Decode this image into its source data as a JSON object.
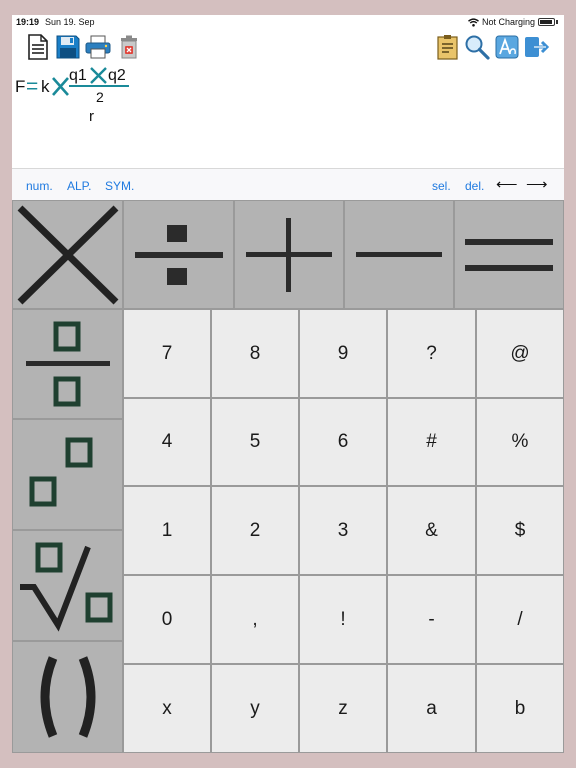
{
  "status_bar": {
    "time": "19:19",
    "date": "Sun 19. Sep",
    "network": "Not Charging"
  },
  "toolbar": {
    "left_icons": [
      "new-document-icon",
      "save-icon",
      "print-icon",
      "trash-icon"
    ],
    "right_icons": [
      "notes-icon",
      "search-icon",
      "font-icon",
      "export-icon"
    ]
  },
  "formula": {
    "f": "F",
    "eq": "=",
    "k": "k",
    "q1": "q1",
    "q2": "q2",
    "exp": "2",
    "r": "r"
  },
  "mode_bar": {
    "num": "num.",
    "alp": "ALP.",
    "sym": "SYM.",
    "sel": "sel.",
    "del": "del.",
    "left_arrow": "⟵",
    "right_arrow": "⟶"
  },
  "keypad": {
    "operators": [
      "multiply",
      "divide",
      "plus",
      "minus",
      "equals"
    ],
    "templates": [
      "fraction",
      "power",
      "root",
      "parentheses"
    ],
    "rows": [
      [
        "7",
        "8",
        "9",
        "?",
        "@"
      ],
      [
        "4",
        "5",
        "6",
        "#",
        "%"
      ],
      [
        "1",
        "2",
        "3",
        "&",
        "$"
      ],
      [
        "0",
        ",",
        "!",
        "-",
        "/"
      ],
      [
        "x",
        "y",
        "z",
        "a",
        "b"
      ]
    ]
  },
  "colors": {
    "formula_operator": "#1a8a99",
    "link": "#1f7ae0",
    "operator_key": "#b3b3b3",
    "number_key": "#ececec",
    "template_box": "#1f4030"
  }
}
